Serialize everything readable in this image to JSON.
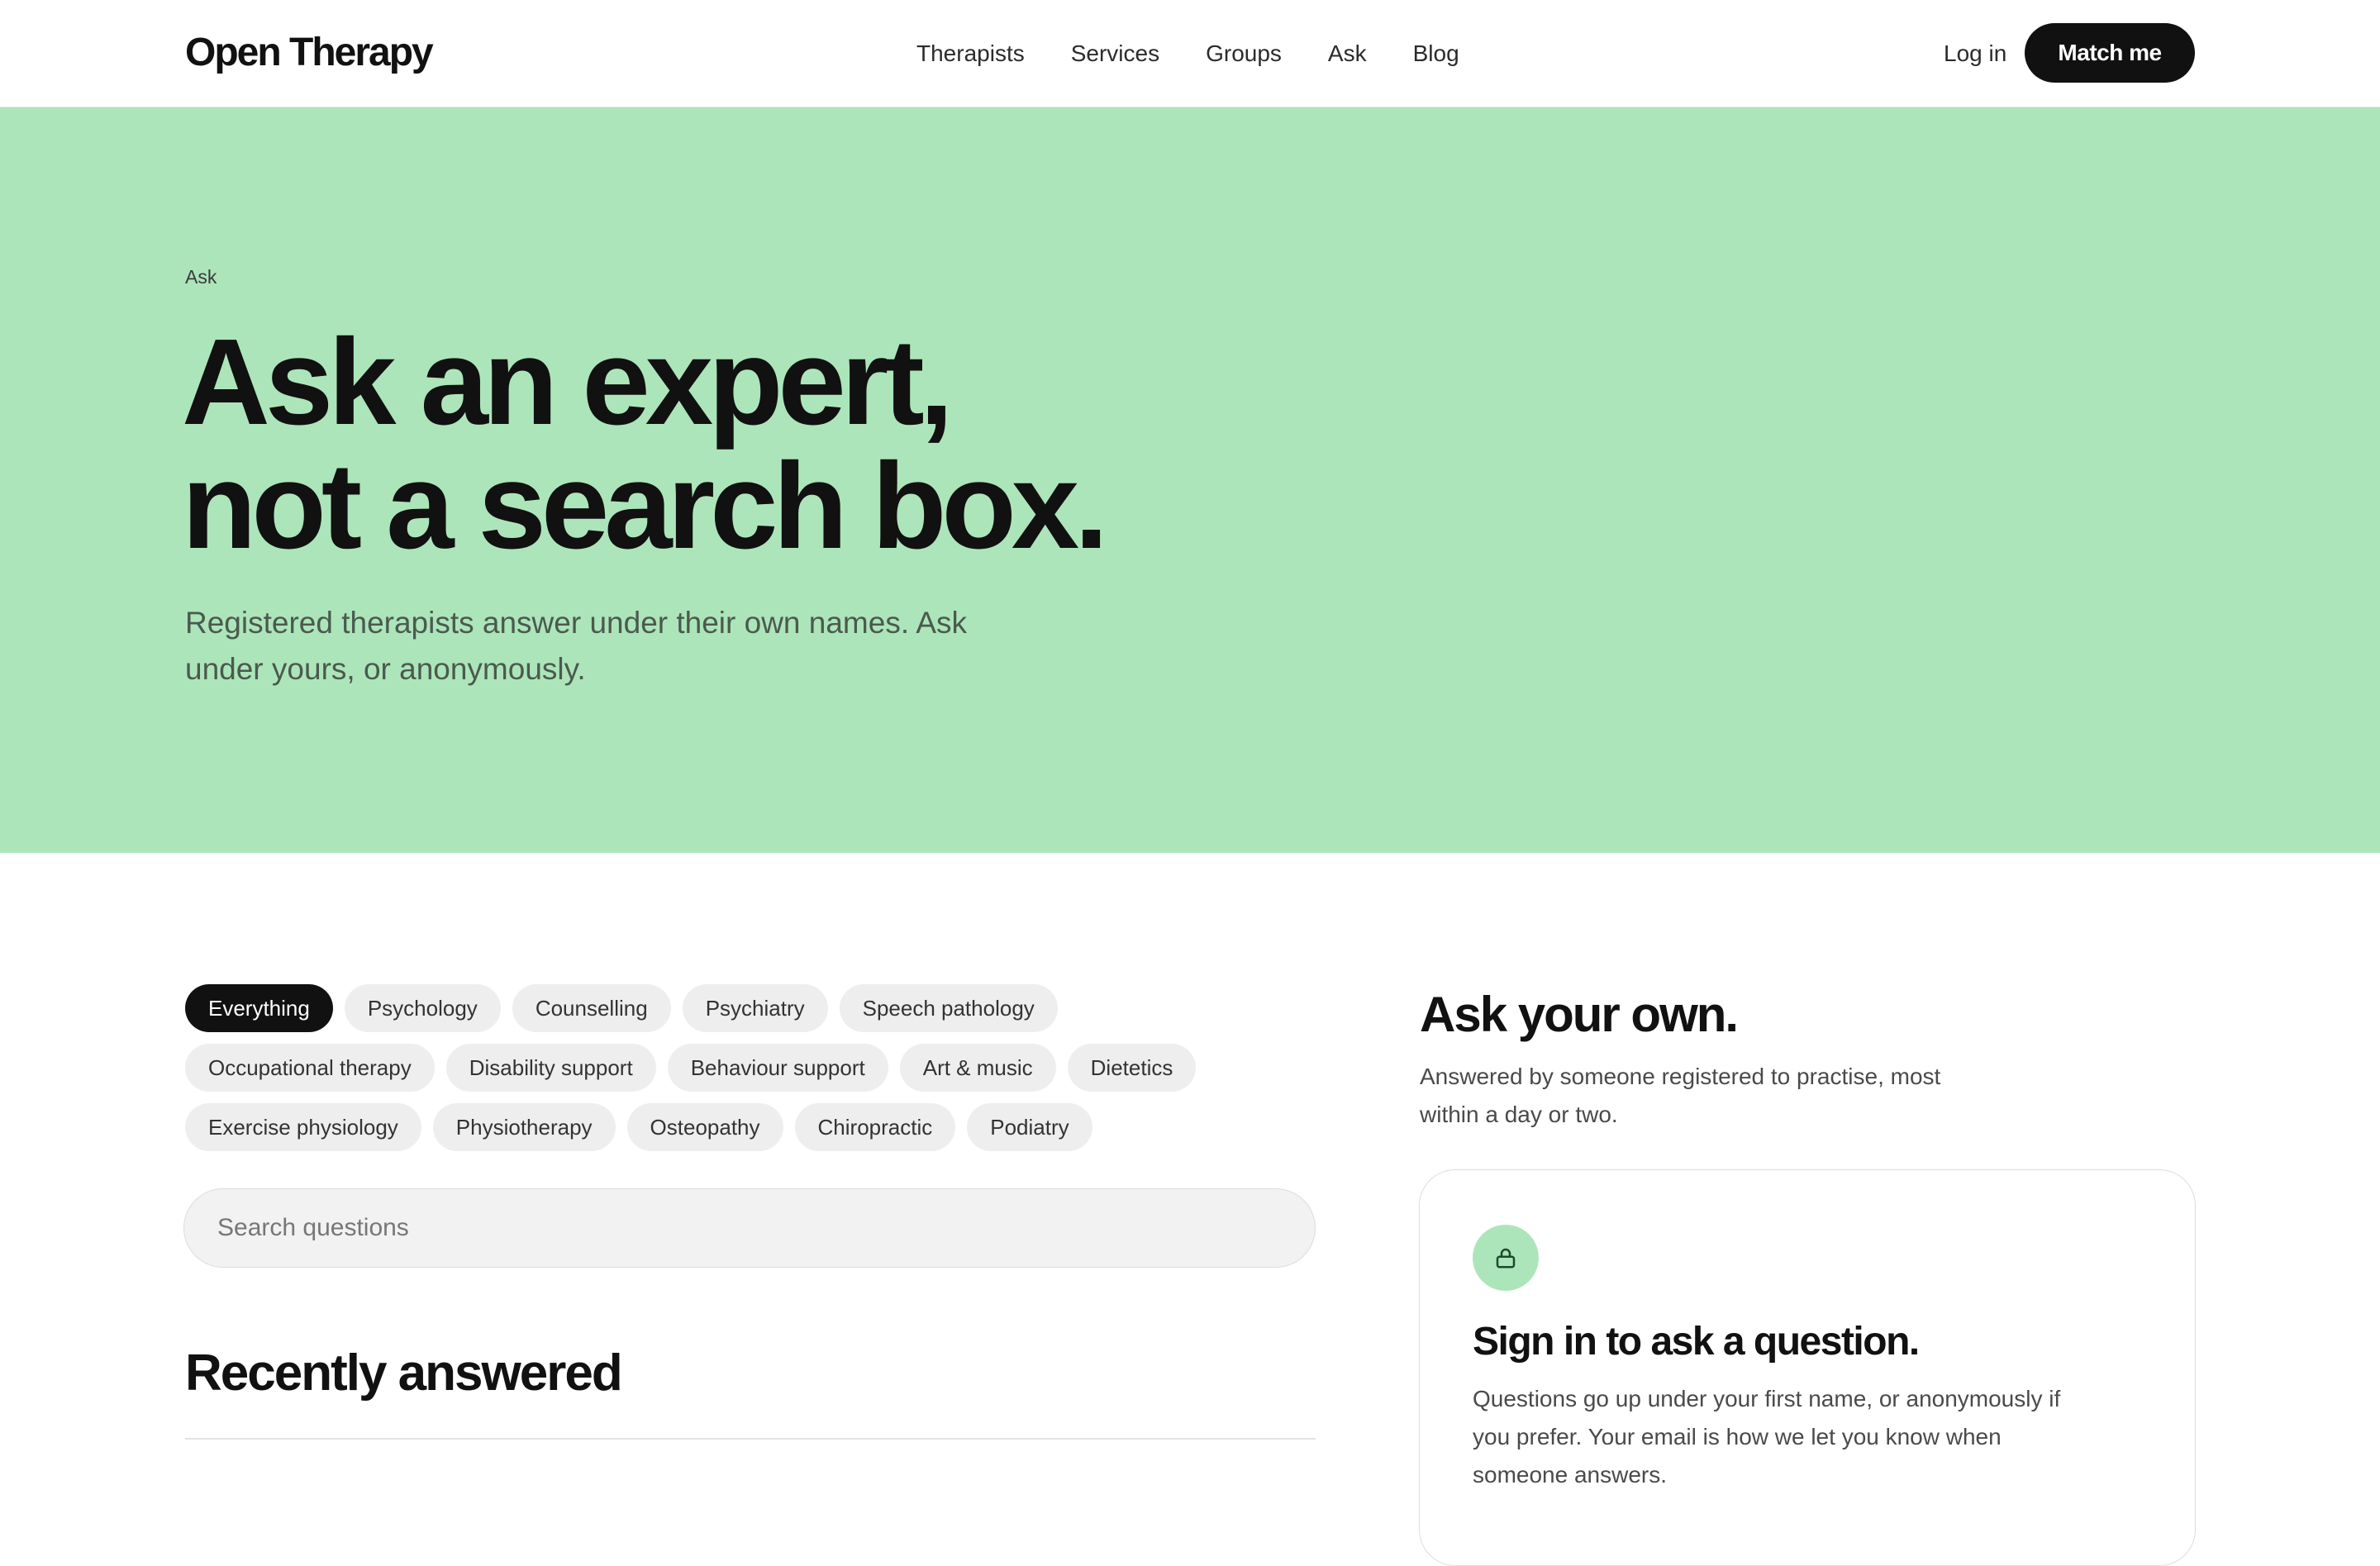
{
  "brand": {
    "name": "Open Therapy"
  },
  "nav": {
    "items": [
      "Therapists",
      "Services",
      "Groups",
      "Ask",
      "Blog"
    ],
    "login_label": "Log in",
    "cta_label": "Match me"
  },
  "hero": {
    "eyebrow": "Ask",
    "title_line1": "Ask an expert,",
    "title_line2": "not a search box.",
    "subtitle": "Registered therapists answer under their own names. Ask under yours, or anonymously.",
    "background_color": "#ade5ba"
  },
  "filters": {
    "active": "Everything",
    "rows": [
      [
        "Everything",
        "Psychology",
        "Counselling",
        "Psychiatry",
        "Speech pathology"
      ],
      [
        "Occupational therapy",
        "Disability support",
        "Behaviour support",
        "Art & music",
        "Dietetics"
      ],
      [
        "Exercise physiology",
        "Physiotherapy",
        "Osteopathy",
        "Chiropractic",
        "Podiatry"
      ]
    ]
  },
  "search": {
    "placeholder": "Search questions",
    "value": ""
  },
  "recent": {
    "title": "Recently answered"
  },
  "ask_own": {
    "title": "Ask your own.",
    "subtitle": "Answered by someone registered to practise, most within a day or two.",
    "card": {
      "icon": "lock-icon",
      "title": "Sign in to ask a question.",
      "text": "Questions go up under your first name, or anonymously if you prefer. Your email is how we let you know when someone answers."
    }
  }
}
